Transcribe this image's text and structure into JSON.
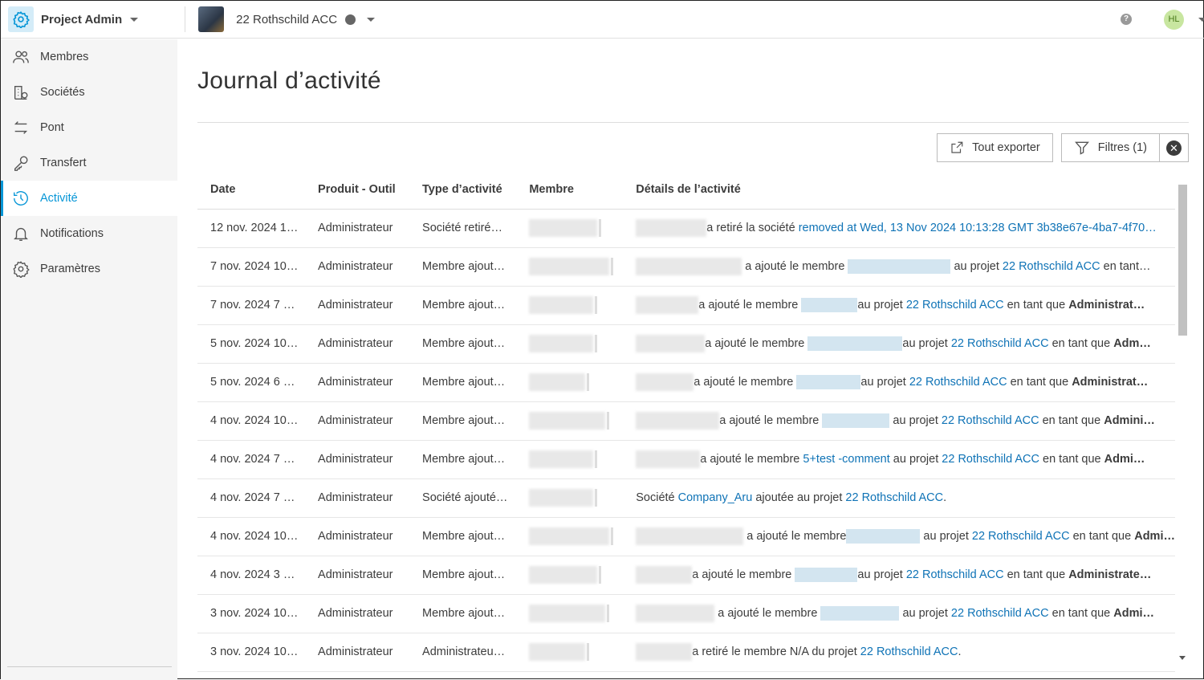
{
  "header": {
    "app_title": "Project Admin",
    "project_name": "22 Rothschild ACC",
    "avatar_initials": "HL",
    "help": "?"
  },
  "sidebar": {
    "items": [
      {
        "label": "Membres",
        "icon": "users-icon"
      },
      {
        "label": "Sociétés",
        "icon": "companies-icon"
      },
      {
        "label": "Pont",
        "icon": "bridge-icon"
      },
      {
        "label": "Transfert",
        "icon": "key-icon"
      },
      {
        "label": "Activité",
        "icon": "history-icon",
        "active": true
      },
      {
        "label": "Notifications",
        "icon": "bell-icon"
      },
      {
        "label": "Paramètres",
        "icon": "gear-icon"
      }
    ]
  },
  "page": {
    "title": "Journal d’activité",
    "export_label": "Tout exporter",
    "filters_label": "Filtres (1)"
  },
  "table": {
    "columns": [
      "Date",
      "Produit - Outil",
      "Type d’activité",
      "Membre",
      "Détails de l’activité"
    ],
    "rows": [
      {
        "date": "12 nov. 2024 1…",
        "product": "Administrateur",
        "type": "Société retiré…",
        "details": [
          {
            "blur": 1
          },
          {
            "t": "a retiré la société "
          },
          {
            "t": "removed at Wed, 13 Nov 2024 10:13:28 GMT 3b38e67e-4ba7-4f70…",
            "link": true
          }
        ]
      },
      {
        "date": "7 nov. 2024 10…",
        "product": "Administrateur",
        "type": "Membre ajout…",
        "details": [
          {
            "blur": 1
          },
          {
            "t": " a ajouté le membre "
          },
          {
            "lblur": 1
          },
          {
            "t": " au projet "
          },
          {
            "t": "22 Rothschild ACC",
            "link": true
          },
          {
            "t": " en tant…"
          }
        ]
      },
      {
        "date": "7 nov. 2024 7 …",
        "product": "Administrateur",
        "type": "Membre ajout…",
        "details": [
          {
            "blur": 1
          },
          {
            "t": "a ajouté le membre "
          },
          {
            "lblur": 1
          },
          {
            "t": "au projet "
          },
          {
            "t": "22 Rothschild ACC",
            "link": true
          },
          {
            "t": " en tant que "
          },
          {
            "t": "Administrat…",
            "bold": true
          }
        ]
      },
      {
        "date": "5 nov. 2024 10…",
        "product": "Administrateur",
        "type": "Membre ajout…",
        "details": [
          {
            "blur": 1
          },
          {
            "t": "a ajouté le membre "
          },
          {
            "lblur": 1
          },
          {
            "t": "au projet "
          },
          {
            "t": "22 Rothschild ACC",
            "link": true
          },
          {
            "t": " en tant que "
          },
          {
            "t": "Adm…",
            "bold": true
          }
        ]
      },
      {
        "date": "5 nov. 2024 6 …",
        "product": "Administrateur",
        "type": "Membre ajout…",
        "details": [
          {
            "blur": 1
          },
          {
            "t": "a ajouté le membre "
          },
          {
            "lblur": 1
          },
          {
            "t": "au projet "
          },
          {
            "t": "22 Rothschild ACC",
            "link": true
          },
          {
            "t": " en tant que "
          },
          {
            "t": "Administrat…",
            "bold": true
          }
        ]
      },
      {
        "date": "4 nov. 2024 10…",
        "product": "Administrateur",
        "type": "Membre ajout…",
        "details": [
          {
            "blur": 1
          },
          {
            "t": "a ajouté le membre "
          },
          {
            "lblur": 1
          },
          {
            "t": " au projet "
          },
          {
            "t": "22 Rothschild ACC",
            "link": true
          },
          {
            "t": " en tant que "
          },
          {
            "t": "Admini…",
            "bold": true
          }
        ]
      },
      {
        "date": "4 nov. 2024 7 …",
        "product": "Administrateur",
        "type": "Membre ajout…",
        "details": [
          {
            "blur": 1
          },
          {
            "t": "a ajouté le membre "
          },
          {
            "t": "5+test -comment",
            "link": true
          },
          {
            "t": " au projet "
          },
          {
            "t": "22 Rothschild ACC",
            "link": true
          },
          {
            "t": " en tant que "
          },
          {
            "t": "Admi…",
            "bold": true
          }
        ]
      },
      {
        "date": "4 nov. 2024 7 …",
        "product": "Administrateur",
        "type": "Société ajouté…",
        "details": [
          {
            "t": "Société "
          },
          {
            "t": "Company_Aru",
            "link": true
          },
          {
            "t": " ajoutée au projet "
          },
          {
            "t": "22 Rothschild ACC",
            "link": true
          },
          {
            "t": "."
          }
        ]
      },
      {
        "date": "4 nov. 2024 10…",
        "product": "Administrateur",
        "type": "Membre ajout…",
        "details": [
          {
            "blur": 1
          },
          {
            "t": " a ajouté le membre"
          },
          {
            "lblur": 1
          },
          {
            "t": " au projet "
          },
          {
            "t": "22 Rothschild ACC",
            "link": true
          },
          {
            "t": " en tant que "
          },
          {
            "t": "Admi…",
            "bold": true
          }
        ]
      },
      {
        "date": "4 nov. 2024 3 …",
        "product": "Administrateur",
        "type": "Membre ajout…",
        "details": [
          {
            "blur": 1
          },
          {
            "t": "a ajouté le membre "
          },
          {
            "lblur": 1
          },
          {
            "t": "au projet "
          },
          {
            "t": "22 Rothschild ACC",
            "link": true
          },
          {
            "t": " en tant que "
          },
          {
            "t": "Administrate…",
            "bold": true
          }
        ]
      },
      {
        "date": "3 nov. 2024 10…",
        "product": "Administrateur",
        "type": "Membre ajout…",
        "details": [
          {
            "blur": 1
          },
          {
            "t": " a ajouté le membre "
          },
          {
            "lblur": 1
          },
          {
            "t": " au projet "
          },
          {
            "t": "22 Rothschild ACC",
            "link": true
          },
          {
            "t": " en tant que "
          },
          {
            "t": "Admi…",
            "bold": true
          }
        ]
      },
      {
        "date": "3 nov. 2024 10…",
        "product": "Administrateur",
        "type": "Administrateu…",
        "details": [
          {
            "blur": 1
          },
          {
            "t": "a retiré le membre N/A du projet "
          },
          {
            "t": "22 Rothschild ACC",
            "link": true
          },
          {
            "t": "."
          }
        ]
      }
    ]
  }
}
